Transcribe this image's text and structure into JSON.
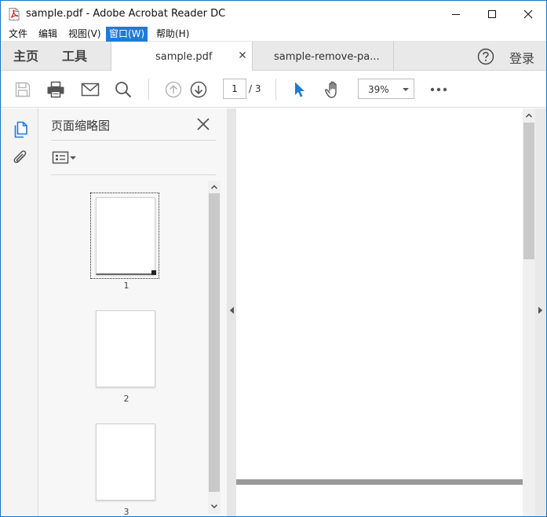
{
  "window": {
    "title": "sample.pdf - Adobe Acrobat Reader DC",
    "icon": "acrobat-pdf-icon",
    "controls": [
      "minimize-icon",
      "maximize-icon",
      "close-icon"
    ]
  },
  "menubar": {
    "items": [
      {
        "label": "文件"
      },
      {
        "label": "编辑"
      },
      {
        "label": "视图(V)"
      },
      {
        "label": "窗口(W)",
        "active": true
      },
      {
        "label": "帮助(H)"
      }
    ]
  },
  "tabbar": {
    "nav": [
      {
        "label": "主页"
      },
      {
        "label": "工具"
      }
    ],
    "docs": [
      {
        "label": "sample.pdf",
        "active": true
      },
      {
        "label": "sample-remove-pa..."
      }
    ],
    "help_icon": "help-icon",
    "signin": "登录"
  },
  "toolbar": {
    "page_current": "1",
    "page_total": "/ 3",
    "zoom": "39%",
    "icons": [
      "save-icon",
      "print-icon",
      "email-icon",
      "search-icon",
      "page-up-icon",
      "page-down-icon",
      "select-cursor-icon",
      "hand-icon",
      "more-icon"
    ],
    "accent": "#1f7ad8"
  },
  "thumbnail_panel": {
    "title": "页面缩略图",
    "pages": [
      {
        "number": "1",
        "selected": true
      },
      {
        "number": "2",
        "selected": false
      },
      {
        "number": "3",
        "selected": false
      }
    ]
  },
  "document": {
    "current_page": 1,
    "page_count": 3
  }
}
